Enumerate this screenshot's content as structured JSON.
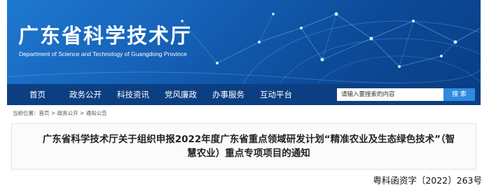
{
  "header": {
    "site_title": "广东省科学技术厅",
    "site_subtitle": "Department of Science and Technology of Guangdong Province"
  },
  "nav": {
    "items": [
      "首页",
      "政务公开",
      "科技资讯",
      "党风廉政",
      "办事服务",
      "互动平台"
    ],
    "search_placeholder": "请输入要搜索的内容",
    "search_button": "搜 索"
  },
  "breadcrumb": {
    "prefix": "当前位置：",
    "items": [
      "首页",
      "政务公开",
      "通知公告"
    ],
    "separator": " > "
  },
  "article": {
    "title": "广东省科学技术厅关于组织申报2022年度广东省重点领域研发计划“精准农业及生态绿色技术”（智慧农业）重点专项项目的通知"
  },
  "document": {
    "number": "粤科函资字〔2022〕263号"
  },
  "colors": {
    "banner": "#1662b8",
    "nav": "#0c3f82",
    "search_button": "#2d8be0"
  }
}
